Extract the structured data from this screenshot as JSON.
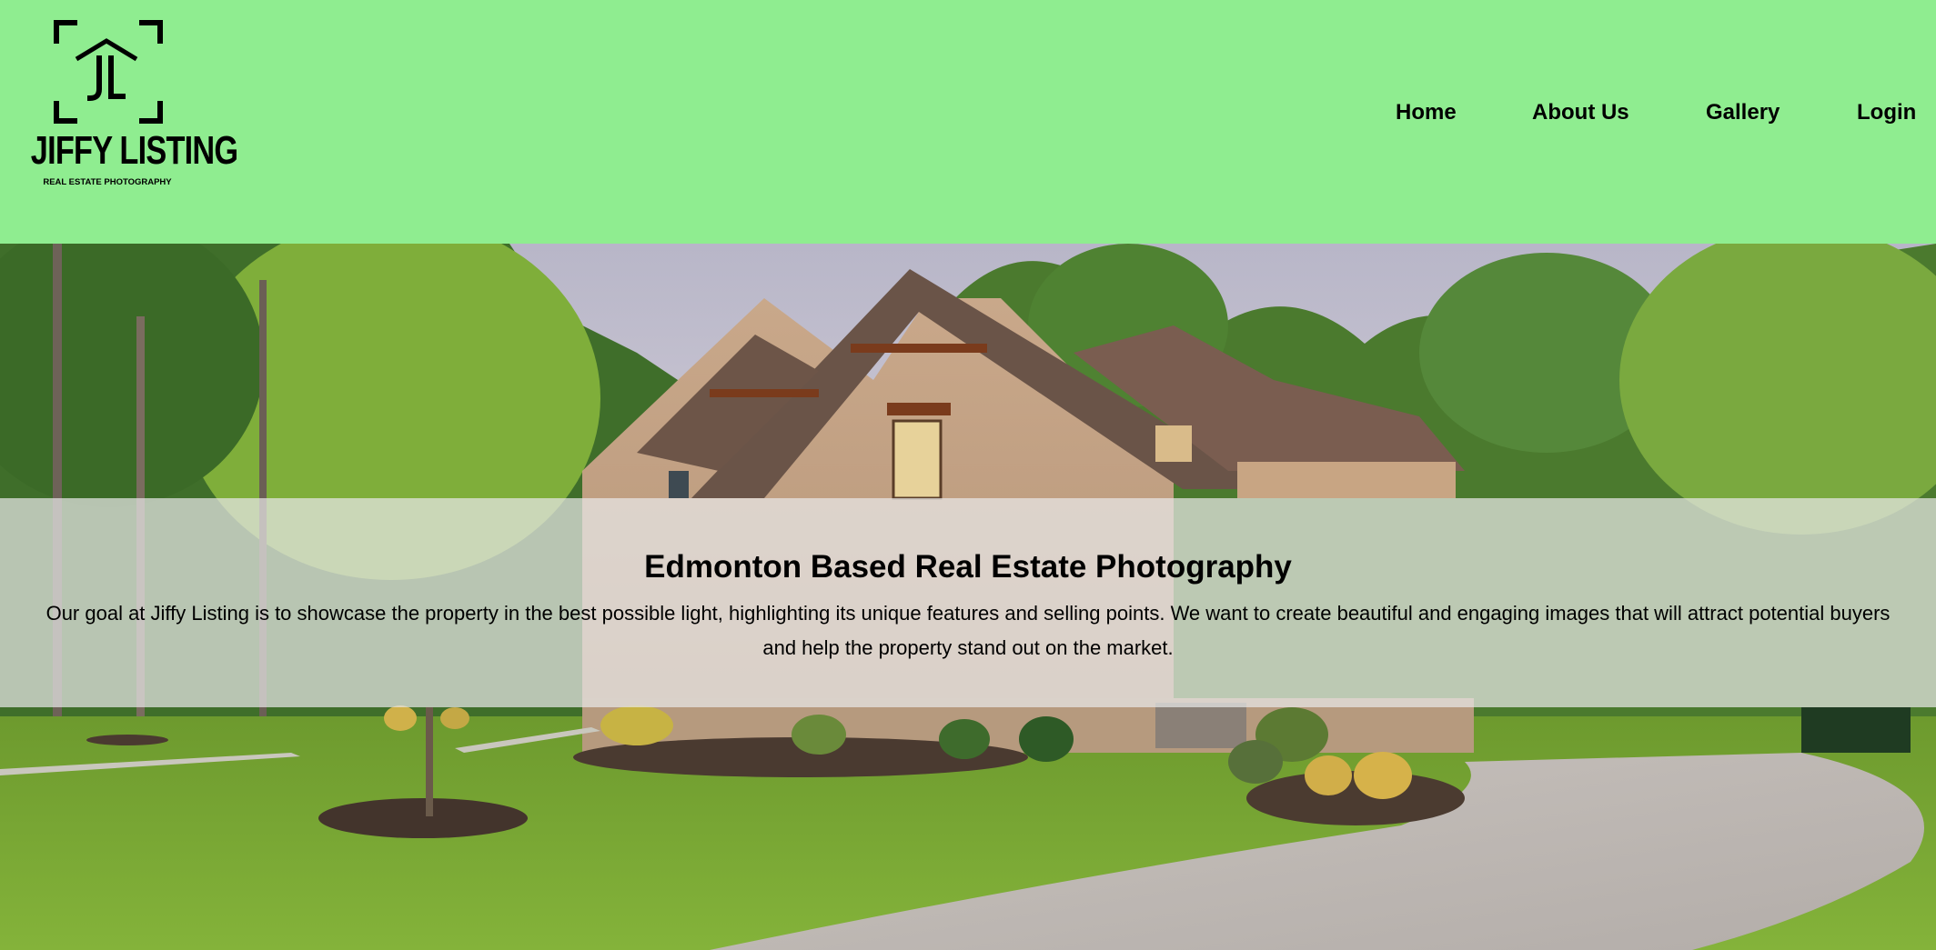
{
  "brand": {
    "logo_monogram": "JL",
    "name": "JIFFY LISTING",
    "tagline": "REAL ESTATE PHOTOGRAPHY"
  },
  "nav": {
    "items": [
      {
        "label": "Home"
      },
      {
        "label": "About Us"
      },
      {
        "label": "Gallery"
      },
      {
        "label": "Login"
      }
    ]
  },
  "hero": {
    "image": "house-exterior-photo",
    "title": "Edmonton Based Real Estate Photography",
    "description": "Our goal at Jiffy Listing is to showcase the property in the best possible light, highlighting its unique features and selling points. We want to create beautiful and engaging images that will attract potential buyers and help the property stand out on the market."
  },
  "colors": {
    "header_bg": "#8fed90",
    "overlay_bg": "#e8e8e8",
    "text": "#000000"
  }
}
